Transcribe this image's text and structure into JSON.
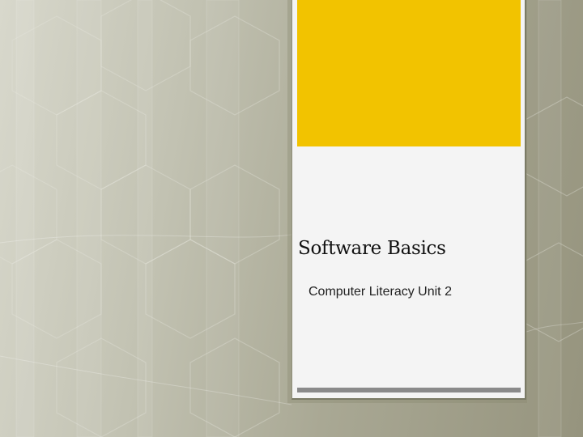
{
  "slide": {
    "title": "Software Basics",
    "subtitle": "Computer Literacy Unit 2"
  },
  "colors": {
    "accent": "#f2c300",
    "panel": "#f4f4f4",
    "bar": "#8a8a8a",
    "background": "#b8b7a3"
  }
}
